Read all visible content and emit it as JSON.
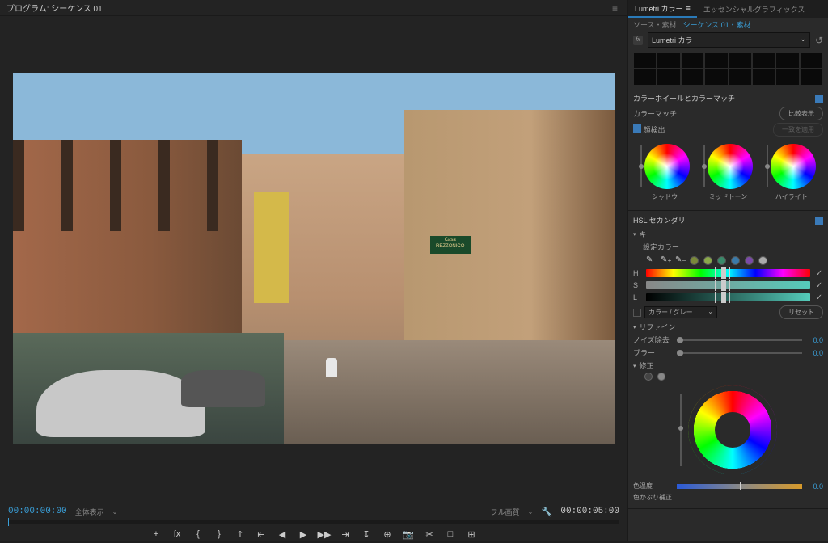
{
  "program": {
    "title": "プログラム: シーケンス 01",
    "menu_icon": "≡"
  },
  "sign_text": "Casa\nREZZONICO",
  "timeline": {
    "timecode_left": "00:00:00:00",
    "display_mode": "全体表示",
    "quality": "フル画質",
    "timecode_right": "00:00:05:00"
  },
  "transport_icons": [
    "+",
    "fx",
    "{",
    "}",
    "↥",
    "⇤",
    "◀",
    "▶",
    "▶▶",
    "⇥",
    "↧",
    "⊕",
    "📷",
    "✂",
    "□",
    "⊞"
  ],
  "panel": {
    "tabs": {
      "lumetri": "Lumetri カラー",
      "graphics": "エッセンシャルグラフィックス"
    },
    "sub_tabs": {
      "source": "ソース・素材",
      "sequence": "シーケンス 01・素材"
    },
    "effect_name": "Lumetri カラー",
    "reset_icon": "↺"
  },
  "wheels_section": {
    "title": "カラーホイールとカラーマッチ",
    "match_label": "カラーマッチ",
    "compare_btn": "比較表示",
    "face_detect": "顔検出",
    "apply_btn": "一致を適用",
    "wheel_labels": {
      "shadow": "シャドウ",
      "midtone": "ミッドトーン",
      "highlight": "ハイライト"
    }
  },
  "hsl_section": {
    "title": "HSL セカンダリ",
    "key_label": "キー",
    "set_color": "設定カラー",
    "swatches": [
      "#7a8a3a",
      "#8aa84a",
      "#3a8a6a",
      "#3a7aa8",
      "#7a4aa8",
      "#aaaaaa"
    ],
    "h": "H",
    "s": "S",
    "l": "L",
    "color_gray": "カラー / グレー",
    "reset_btn": "リセット",
    "refine_label": "リファイン",
    "denoise": "ノイズ除去",
    "denoise_val": "0.0",
    "blur": "ブラー",
    "blur_val": "0.0",
    "correction": "修正"
  },
  "bottom": {
    "temperature": "色温度",
    "tint": "色かぶり補正",
    "val": "0.0"
  }
}
